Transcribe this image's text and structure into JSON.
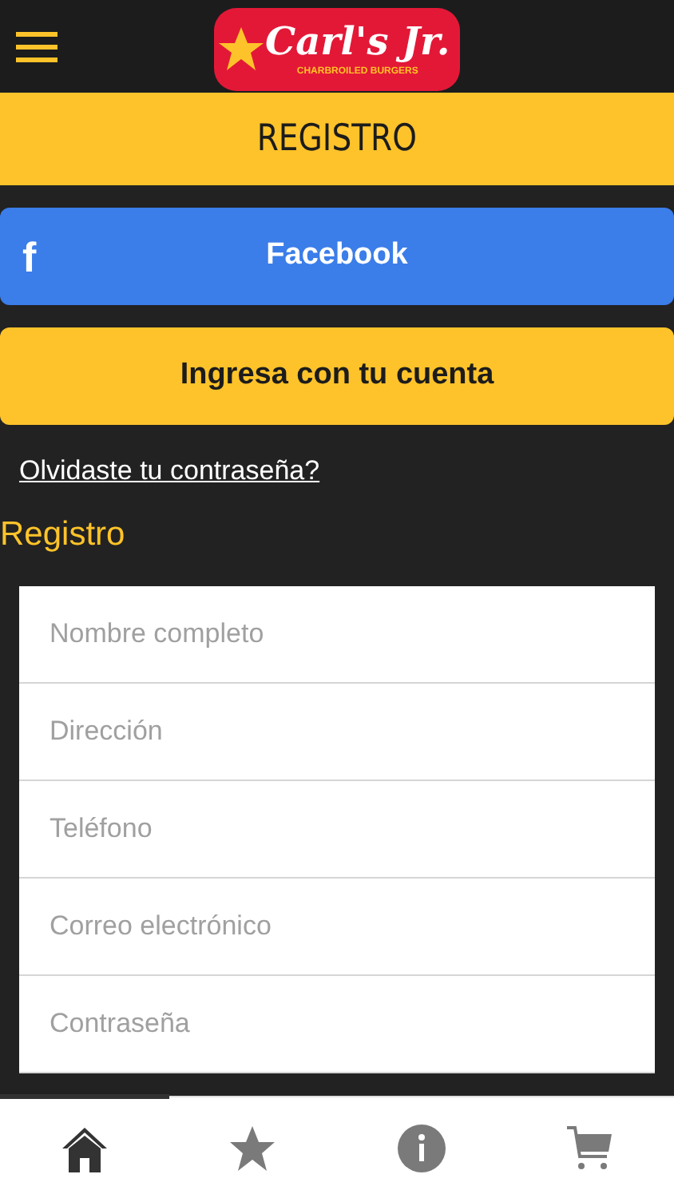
{
  "header": {
    "logo": {
      "name": "Carl's Jr.",
      "tagline": "CHARBROILED BURGERS"
    }
  },
  "title": "REGISTRO",
  "facebook_button": {
    "icon": "f",
    "label": "Facebook"
  },
  "login_button": "Ingresa con tu cuenta",
  "forgot_link": "Olvidaste tu contraseña?",
  "section_title": "Registro",
  "fields": [
    {
      "placeholder": "Nombre completo"
    },
    {
      "placeholder": "Dirección"
    },
    {
      "placeholder": "Teléfono"
    },
    {
      "placeholder": "Correo electrónico"
    },
    {
      "placeholder": "Contraseña"
    }
  ],
  "tabs": [
    {
      "kind": "home",
      "selected": true
    },
    {
      "kind": "star",
      "selected": false
    },
    {
      "kind": "info",
      "selected": false
    },
    {
      "kind": "cart",
      "selected": false
    }
  ]
}
